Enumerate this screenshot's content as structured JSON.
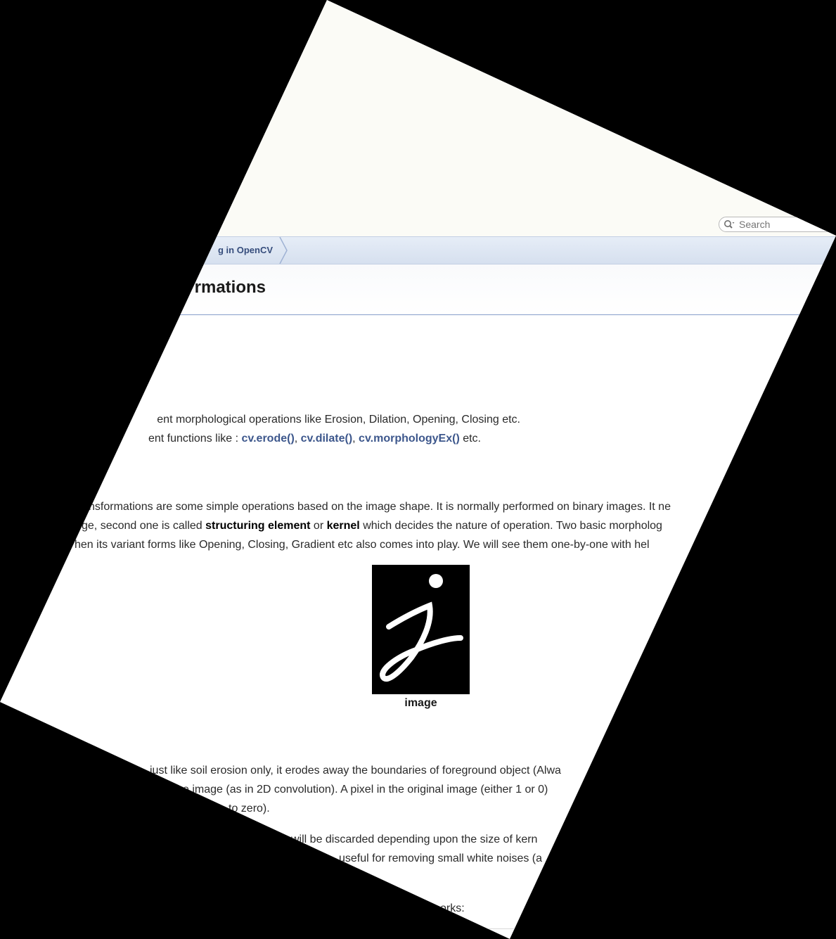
{
  "search": {
    "placeholder": "Search"
  },
  "navbar": {
    "crumb": "g in OpenCV"
  },
  "page": {
    "title": "rmations"
  },
  "goals": {
    "line1": "ent morphological operations like Erosion, Dilation, Opening, Closing etc.",
    "line2_prefix": "ent functions like : ",
    "fn1": "cv.erode()",
    "sep1": ", ",
    "fn2": "cv.dilate()",
    "sep2": ", ",
    "fn3": "cv.morphologyEx()",
    "line2_suffix": " etc."
  },
  "theory": {
    "line1": "nsformations are some simple operations based on the image shape. It is normally performed on binary images. It ne",
    "line2_prefix": "ge, second one is called ",
    "bold1": "structuring element",
    "mid": " or ",
    "bold2": "kernel",
    "line2_suffix": " which decides the nature of operation. Two basic morpholog",
    "line3": "hen its variant forms like Opening, Closing, Gradient etc also comes into play. We will see them one-by-one with hel"
  },
  "figure": {
    "caption": "image"
  },
  "erosion": {
    "line1": "just like soil erosion only, it erodes away the boundaries of foreground object (Alwa",
    "line2": "e image (as in 2D convolution). A pixel in the original image (either 1 or 0)",
    "line3": "to zero).",
    "line4": "will be discarded depending upon the size of kern",
    "line5": "useful for removing small white noises (a",
    "line6": "orks:"
  }
}
